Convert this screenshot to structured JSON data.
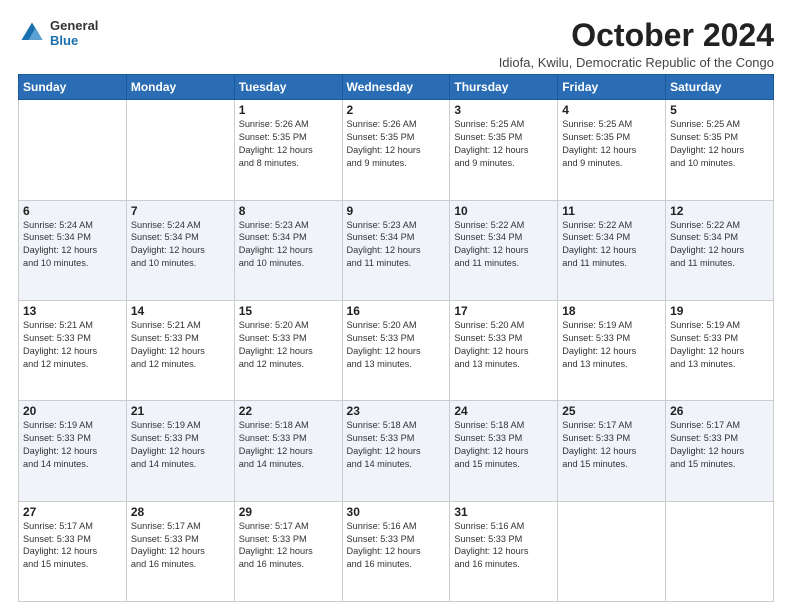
{
  "logo": {
    "general": "General",
    "blue": "Blue"
  },
  "header": {
    "month": "October 2024",
    "subtitle": "Idiofa, Kwilu, Democratic Republic of the Congo"
  },
  "weekdays": [
    "Sunday",
    "Monday",
    "Tuesday",
    "Wednesday",
    "Thursday",
    "Friday",
    "Saturday"
  ],
  "rows": [
    [
      {
        "day": "",
        "info": ""
      },
      {
        "day": "",
        "info": ""
      },
      {
        "day": "1",
        "info": "Sunrise: 5:26 AM\nSunset: 5:35 PM\nDaylight: 12 hours\nand 8 minutes."
      },
      {
        "day": "2",
        "info": "Sunrise: 5:26 AM\nSunset: 5:35 PM\nDaylight: 12 hours\nand 9 minutes."
      },
      {
        "day": "3",
        "info": "Sunrise: 5:25 AM\nSunset: 5:35 PM\nDaylight: 12 hours\nand 9 minutes."
      },
      {
        "day": "4",
        "info": "Sunrise: 5:25 AM\nSunset: 5:35 PM\nDaylight: 12 hours\nand 9 minutes."
      },
      {
        "day": "5",
        "info": "Sunrise: 5:25 AM\nSunset: 5:35 PM\nDaylight: 12 hours\nand 10 minutes."
      }
    ],
    [
      {
        "day": "6",
        "info": "Sunrise: 5:24 AM\nSunset: 5:34 PM\nDaylight: 12 hours\nand 10 minutes."
      },
      {
        "day": "7",
        "info": "Sunrise: 5:24 AM\nSunset: 5:34 PM\nDaylight: 12 hours\nand 10 minutes."
      },
      {
        "day": "8",
        "info": "Sunrise: 5:23 AM\nSunset: 5:34 PM\nDaylight: 12 hours\nand 10 minutes."
      },
      {
        "day": "9",
        "info": "Sunrise: 5:23 AM\nSunset: 5:34 PM\nDaylight: 12 hours\nand 11 minutes."
      },
      {
        "day": "10",
        "info": "Sunrise: 5:22 AM\nSunset: 5:34 PM\nDaylight: 12 hours\nand 11 minutes."
      },
      {
        "day": "11",
        "info": "Sunrise: 5:22 AM\nSunset: 5:34 PM\nDaylight: 12 hours\nand 11 minutes."
      },
      {
        "day": "12",
        "info": "Sunrise: 5:22 AM\nSunset: 5:34 PM\nDaylight: 12 hours\nand 11 minutes."
      }
    ],
    [
      {
        "day": "13",
        "info": "Sunrise: 5:21 AM\nSunset: 5:33 PM\nDaylight: 12 hours\nand 12 minutes."
      },
      {
        "day": "14",
        "info": "Sunrise: 5:21 AM\nSunset: 5:33 PM\nDaylight: 12 hours\nand 12 minutes."
      },
      {
        "day": "15",
        "info": "Sunrise: 5:20 AM\nSunset: 5:33 PM\nDaylight: 12 hours\nand 12 minutes."
      },
      {
        "day": "16",
        "info": "Sunrise: 5:20 AM\nSunset: 5:33 PM\nDaylight: 12 hours\nand 13 minutes."
      },
      {
        "day": "17",
        "info": "Sunrise: 5:20 AM\nSunset: 5:33 PM\nDaylight: 12 hours\nand 13 minutes."
      },
      {
        "day": "18",
        "info": "Sunrise: 5:19 AM\nSunset: 5:33 PM\nDaylight: 12 hours\nand 13 minutes."
      },
      {
        "day": "19",
        "info": "Sunrise: 5:19 AM\nSunset: 5:33 PM\nDaylight: 12 hours\nand 13 minutes."
      }
    ],
    [
      {
        "day": "20",
        "info": "Sunrise: 5:19 AM\nSunset: 5:33 PM\nDaylight: 12 hours\nand 14 minutes."
      },
      {
        "day": "21",
        "info": "Sunrise: 5:19 AM\nSunset: 5:33 PM\nDaylight: 12 hours\nand 14 minutes."
      },
      {
        "day": "22",
        "info": "Sunrise: 5:18 AM\nSunset: 5:33 PM\nDaylight: 12 hours\nand 14 minutes."
      },
      {
        "day": "23",
        "info": "Sunrise: 5:18 AM\nSunset: 5:33 PM\nDaylight: 12 hours\nand 14 minutes."
      },
      {
        "day": "24",
        "info": "Sunrise: 5:18 AM\nSunset: 5:33 PM\nDaylight: 12 hours\nand 15 minutes."
      },
      {
        "day": "25",
        "info": "Sunrise: 5:17 AM\nSunset: 5:33 PM\nDaylight: 12 hours\nand 15 minutes."
      },
      {
        "day": "26",
        "info": "Sunrise: 5:17 AM\nSunset: 5:33 PM\nDaylight: 12 hours\nand 15 minutes."
      }
    ],
    [
      {
        "day": "27",
        "info": "Sunrise: 5:17 AM\nSunset: 5:33 PM\nDaylight: 12 hours\nand 15 minutes."
      },
      {
        "day": "28",
        "info": "Sunrise: 5:17 AM\nSunset: 5:33 PM\nDaylight: 12 hours\nand 16 minutes."
      },
      {
        "day": "29",
        "info": "Sunrise: 5:17 AM\nSunset: 5:33 PM\nDaylight: 12 hours\nand 16 minutes."
      },
      {
        "day": "30",
        "info": "Sunrise: 5:16 AM\nSunset: 5:33 PM\nDaylight: 12 hours\nand 16 minutes."
      },
      {
        "day": "31",
        "info": "Sunrise: 5:16 AM\nSunset: 5:33 PM\nDaylight: 12 hours\nand 16 minutes."
      },
      {
        "day": "",
        "info": ""
      },
      {
        "day": "",
        "info": ""
      }
    ]
  ]
}
